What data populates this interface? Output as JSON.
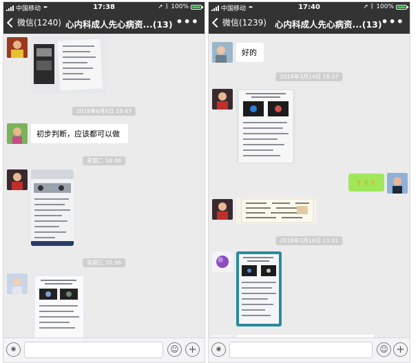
{
  "left": {
    "status": {
      "carrier": "中国移动",
      "time": "17:38",
      "battery": "100%"
    },
    "nav": {
      "back_label": "微信(1240)",
      "title": "心内科成人先心病资...(13)",
      "more": "•••"
    },
    "messages": {
      "t1": "2018年6月6日 18:47",
      "text1": "初步判断，应该都可以做",
      "t2": "星期二 18:48",
      "t3": "星期三 10:36"
    }
  },
  "right": {
    "status": {
      "carrier": "中国移动",
      "time": "17:40",
      "battery": "100%"
    },
    "nav": {
      "back_label": "微信(1239)",
      "title": "心内科成人先心病资...(13)",
      "more": "•••"
    },
    "messages": {
      "text1": "好的",
      "t1": "2018年3月14日 18:37",
      "t2": "2018年3月16日 11:01"
    }
  },
  "icons": {
    "voice": "voice-icon",
    "emoji": "emoji-icon",
    "plus": "plus-icon",
    "back": "chevron-left-icon"
  },
  "colors": {
    "nav_bg": "#333333",
    "chat_bg": "#ebebeb",
    "bubble_self": "#a0e75a",
    "bubble_other": "#ffffff"
  }
}
